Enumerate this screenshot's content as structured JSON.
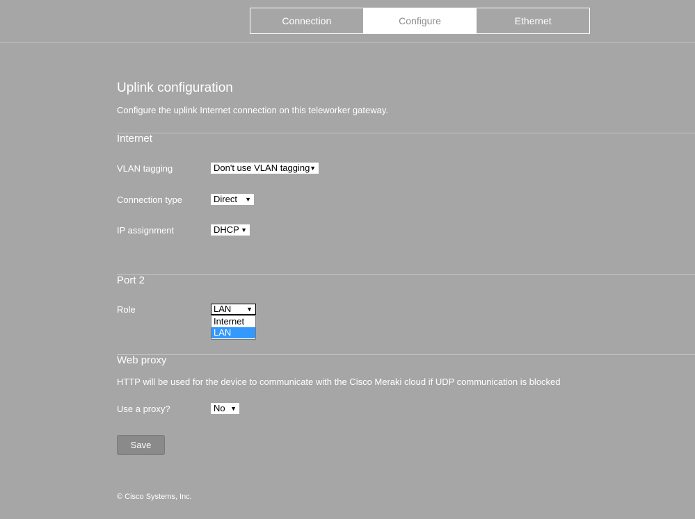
{
  "tabs": [
    {
      "label": "Connection",
      "active": false
    },
    {
      "label": "Configure",
      "active": true
    },
    {
      "label": "Ethernet",
      "active": false
    }
  ],
  "page": {
    "title": "Uplink configuration",
    "subtitle": "Configure the uplink Internet connection on this teleworker gateway."
  },
  "internet": {
    "heading": "Internet",
    "vlan_label": "VLAN tagging",
    "vlan_value": "Don't use VLAN tagging",
    "conn_type_label": "Connection type",
    "conn_type_value": "Direct",
    "ip_label": "IP assignment",
    "ip_value": "DHCP"
  },
  "port2": {
    "heading": "Port 2",
    "role_label": "Role",
    "role_value": "LAN",
    "role_options": [
      "Internet",
      "LAN"
    ],
    "role_highlighted": "LAN"
  },
  "proxy": {
    "heading": "Web proxy",
    "description": "HTTP will be used for the device to communicate with the Cisco Meraki cloud if UDP communication is blocked",
    "use_label": "Use a proxy?",
    "use_value": "No"
  },
  "actions": {
    "save_label": "Save"
  },
  "footer": {
    "copyright": "© Cisco Systems, Inc."
  },
  "icons": {
    "dropdown_arrow": "triangle-down-icon"
  },
  "colors": {
    "background": "#a6a6a6",
    "highlight": "#3399ff",
    "button": "#8a8a8a"
  }
}
